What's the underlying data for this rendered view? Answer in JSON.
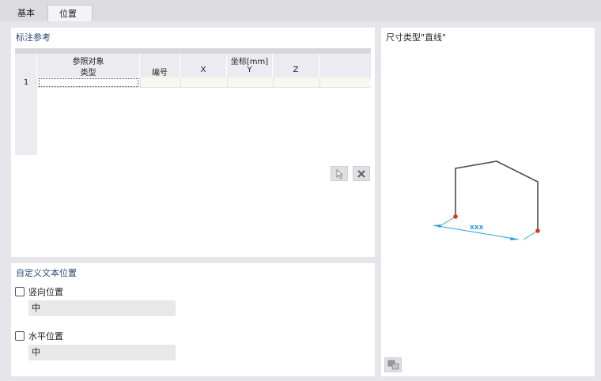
{
  "tabs": [
    {
      "label": "基本",
      "active": false
    },
    {
      "label": "位置",
      "active": true
    }
  ],
  "annotation_panel": {
    "title": "标注参考",
    "columns": {
      "ref_group": "参照对象",
      "type": "类型",
      "number": "编号",
      "coord_group": "坐标[mm]",
      "x": "X",
      "y": "Y",
      "z": "Z"
    },
    "rows": [
      {
        "index": "1",
        "type": "",
        "number": "",
        "x": "",
        "y": "",
        "z": ""
      }
    ],
    "icons": {
      "pick": "pointer-select-icon",
      "delete": "close-icon"
    }
  },
  "custom_text_panel": {
    "title": "自定义文本位置",
    "vertical": {
      "label": "竖向位置",
      "checked": false,
      "value": "中"
    },
    "horizontal": {
      "label": "水平位置",
      "checked": false,
      "value": "中"
    }
  },
  "preview_panel": {
    "title": "尺寸类型\"直线\"",
    "dimension_text": "xxx",
    "colors": {
      "frame": "#4a4a52",
      "dimension": "#2a9fd8",
      "node": "#d23a1e"
    },
    "icons": {
      "view": "view-options-icon"
    }
  }
}
